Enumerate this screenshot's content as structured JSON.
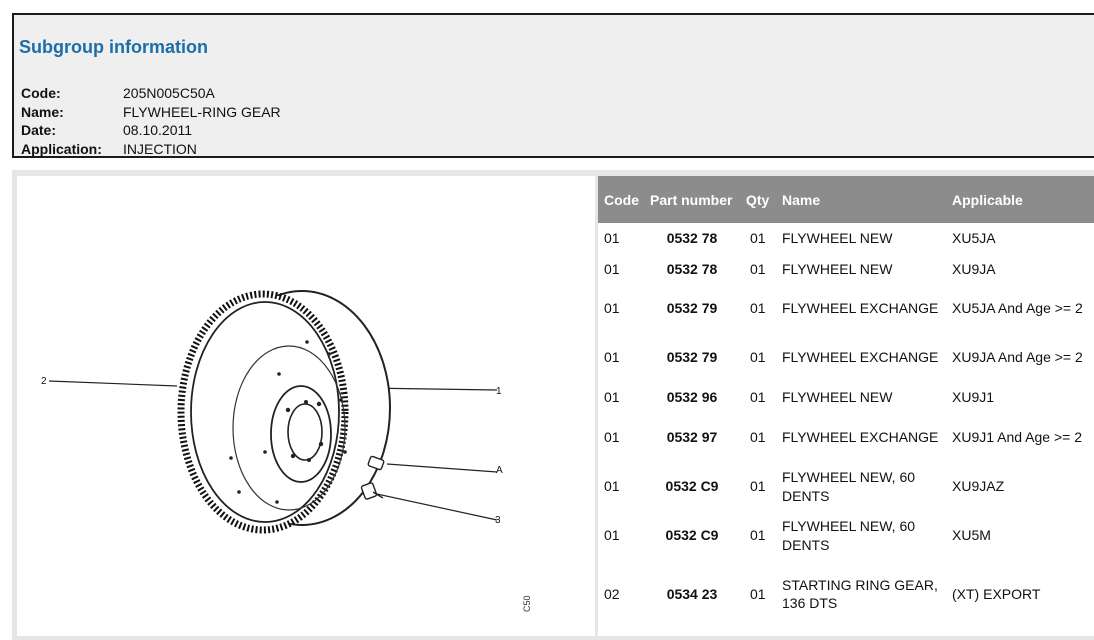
{
  "subgroup": {
    "title": "Subgroup information",
    "fields": [
      {
        "label": "Code:",
        "value": "205N005C50A"
      },
      {
        "label": "Name:",
        "value": "FLYWHEEL-RING GEAR"
      },
      {
        "label": "Date:",
        "value": "08.10.2011"
      },
      {
        "label": "Application:",
        "value": "INJECTION"
      }
    ]
  },
  "drawing": {
    "callouts": [
      "2",
      "1",
      "A",
      "3"
    ],
    "side_code": "C50"
  },
  "parts_table": {
    "headers": {
      "code": "Code",
      "part_number": "Part number",
      "qty": "Qty",
      "name": "Name",
      "applicable": "Applicable"
    },
    "rows": [
      {
        "code": "01",
        "part_number": "0532 78",
        "qty": "01",
        "name": "FLYWHEEL NEW",
        "applicable": "XU5JA"
      },
      {
        "code": "01",
        "part_number": "0532 78",
        "qty": "01",
        "name": "FLYWHEEL NEW",
        "applicable": "XU9JA"
      },
      {
        "code": "01",
        "part_number": "0532 79",
        "qty": "01",
        "name": "FLYWHEEL EXCHANGE",
        "applicable": "XU5JA And Age >= 2"
      },
      {
        "code": "01",
        "part_number": "0532 79",
        "qty": "01",
        "name": "FLYWHEEL EXCHANGE",
        "applicable": "XU9JA And Age >= 2"
      },
      {
        "code": "01",
        "part_number": "0532 96",
        "qty": "01",
        "name": "FLYWHEEL NEW",
        "applicable": "XU9J1"
      },
      {
        "code": "01",
        "part_number": "0532 97",
        "qty": "01",
        "name": "FLYWHEEL EXCHANGE",
        "applicable": "XU9J1 And Age >= 2"
      },
      {
        "code": "01",
        "part_number": "0532 C9",
        "qty": "01",
        "name": "FLYWHEEL NEW, 60 DENTS",
        "applicable": "XU9JAZ"
      },
      {
        "code": "01",
        "part_number": "0532 C9",
        "qty": "01",
        "name": "FLYWHEEL NEW, 60 DENTS",
        "applicable": "XU5M"
      },
      {
        "code": "02",
        "part_number": "0534 23",
        "qty": "01",
        "name": "STARTING RING GEAR, 136 DTS",
        "applicable": "(XT) EXPORT"
      }
    ]
  }
}
